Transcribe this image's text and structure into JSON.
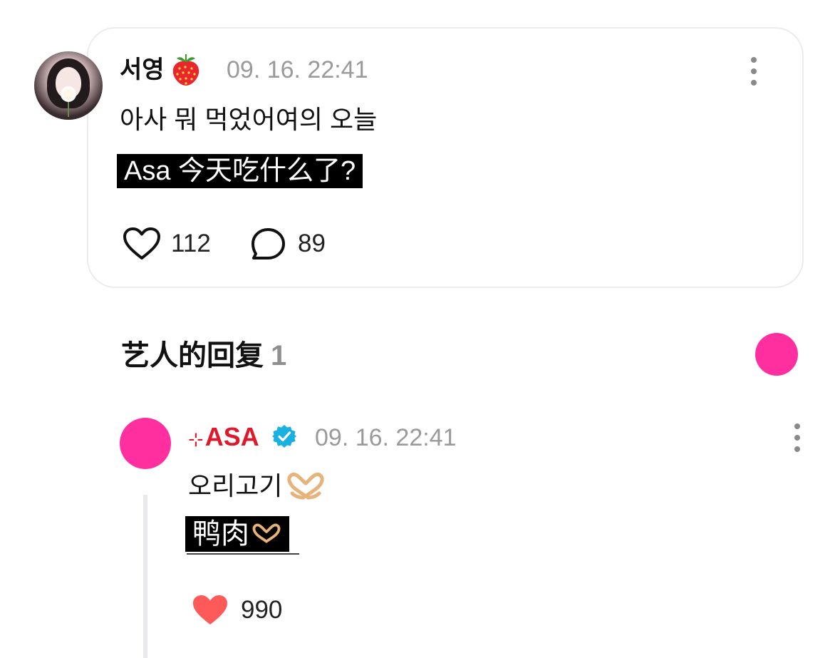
{
  "post": {
    "username": "서영",
    "timestamp": "09. 16. 22:41",
    "text": "아사 뭐 먹었어여의 오늘",
    "translation": "Asa 今天吃什么了?",
    "likes": "112",
    "comments": "89"
  },
  "replies_section": {
    "title": "艺人的回复",
    "count": "1"
  },
  "reply": {
    "sparkle": "⊹",
    "artist": "ASA",
    "timestamp": "09. 16. 22:41",
    "text": "오리고기",
    "translation": "鸭肉",
    "likes": "990"
  },
  "colors": {
    "accent_pink": "#ff2fa0",
    "artist_red": "#e0182b",
    "verified_blue": "#1ab0e0",
    "heart_red": "#ff5a5a"
  },
  "icons": [
    "strawberry-icon",
    "more-icon",
    "heart-outline-icon",
    "comment-icon",
    "verified-badge-icon",
    "heart-hands-emoji",
    "heart-filled-icon"
  ]
}
